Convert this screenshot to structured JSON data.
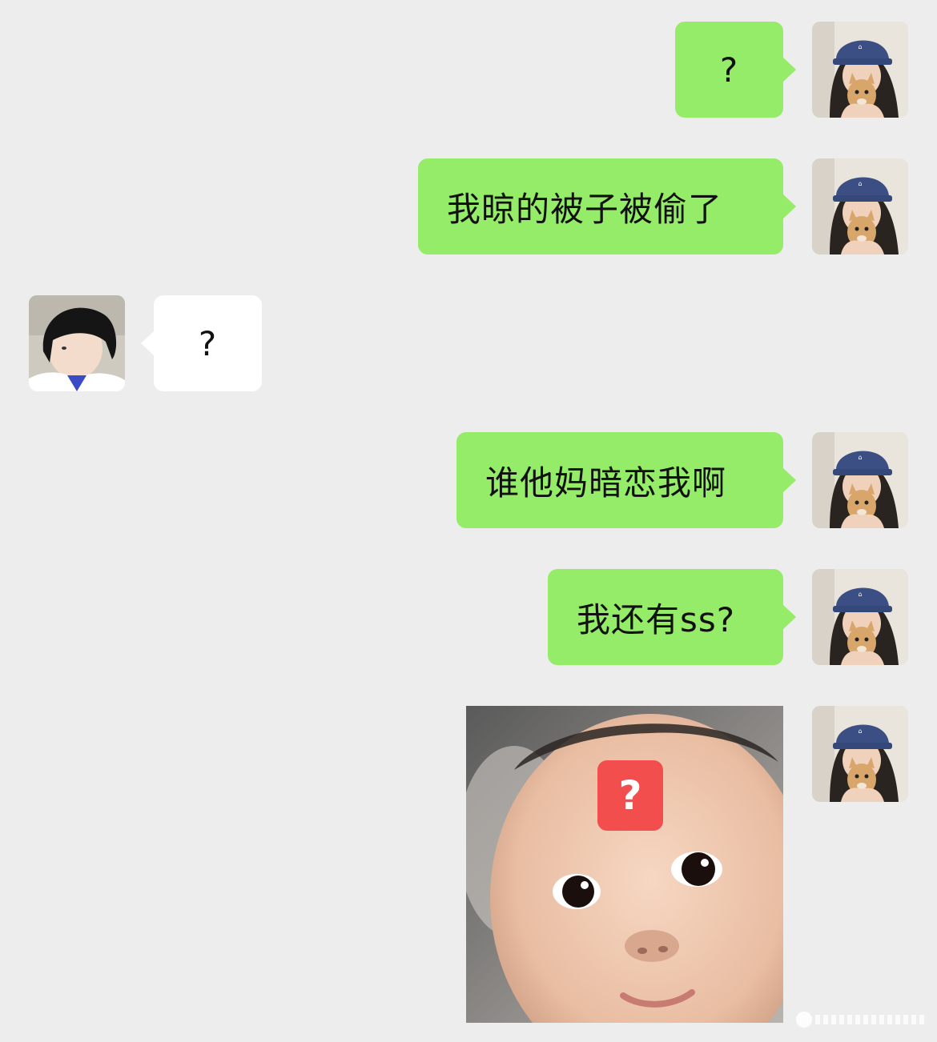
{
  "chat": {
    "messages": [
      {
        "sender": "me",
        "type": "text",
        "text": "?"
      },
      {
        "sender": "me",
        "type": "text",
        "text": "我晾的被子被偷了"
      },
      {
        "sender": "other",
        "type": "text",
        "text": "?"
      },
      {
        "sender": "me",
        "type": "text",
        "text": "谁他妈暗恋我啊"
      },
      {
        "sender": "me",
        "type": "text",
        "text": "我还有ss?"
      },
      {
        "sender": "me",
        "type": "sticker",
        "sticker_icon": "confused-baby-question-sticker",
        "badge_text": "?"
      }
    ]
  },
  "colors": {
    "background": "#ededed",
    "my_bubble": "#95ec69",
    "their_bubble": "#ffffff",
    "badge_red": "#f24e4e"
  }
}
